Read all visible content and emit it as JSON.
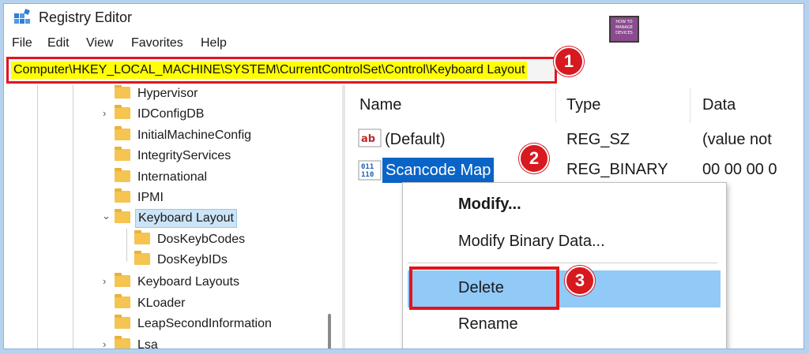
{
  "window": {
    "title": "Registry Editor"
  },
  "logo": {
    "lines": [
      "HOW TO",
      "MANAGE",
      "DEVICES"
    ]
  },
  "menu": [
    "File",
    "Edit",
    "View",
    "Favorites",
    "Help"
  ],
  "address": {
    "path": "Computer\\HKEY_LOCAL_MACHINE\\SYSTEM\\CurrentControlSet\\Control\\Keyboard Layout"
  },
  "callouts": [
    "1",
    "2",
    "3"
  ],
  "tree": {
    "items": [
      {
        "label": "Hypervisor"
      },
      {
        "label": "IDConfigDB"
      },
      {
        "label": "InitialMachineConfig"
      },
      {
        "label": "IntegrityServices"
      },
      {
        "label": "International"
      },
      {
        "label": "IPMI"
      },
      {
        "label": "Keyboard Layout"
      },
      {
        "label": "DosKeybCodes"
      },
      {
        "label": "DosKeybIDs"
      },
      {
        "label": "Keyboard Layouts"
      },
      {
        "label": "KLoader"
      },
      {
        "label": "LeapSecondInformation"
      },
      {
        "label": "Lsa"
      }
    ]
  },
  "list": {
    "columns": [
      "Name",
      "Type",
      "Data"
    ],
    "rows": [
      {
        "icon": "ab",
        "name": "(Default)",
        "type": "REG_SZ",
        "data": "(value not"
      },
      {
        "icon": "011 110",
        "name": "Scancode Map",
        "type": "REG_BINARY",
        "data": "00 00 00 0"
      }
    ]
  },
  "context_menu": {
    "items": [
      "Modify...",
      "Modify Binary Data...",
      "Delete",
      "Rename"
    ]
  },
  "colors": {
    "highlight_yellow": "#ffff00",
    "callout_red": "#d71920",
    "selection_blue": "#0a64c8",
    "menu_hover": "#91c9f7",
    "folder": "#f5c451"
  }
}
